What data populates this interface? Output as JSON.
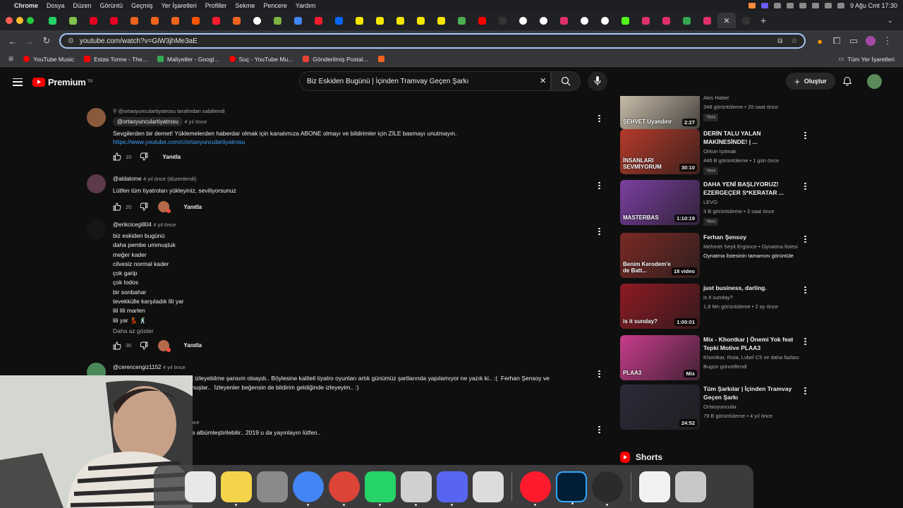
{
  "menubar": {
    "apple": "",
    "app_name": "Chrome",
    "items": [
      "Dosya",
      "Düzen",
      "Görüntü",
      "Geçmiş",
      "Yer İşaretleri",
      "Profiller",
      "Sekme",
      "Pencere",
      "Yardım"
    ],
    "clock": "9 Ağu Cmt  17:30"
  },
  "browser": {
    "tabs": [
      {
        "icon": "whatsapp-icon",
        "color": "#25d366"
      },
      {
        "icon": "ekşi-icon",
        "color": "#81c14b"
      },
      {
        "icon": "pinterest-icon",
        "color": "#e60023"
      },
      {
        "icon": "pinterest-icon",
        "color": "#e60023"
      },
      {
        "icon": "etsy-icon",
        "color": "#f1641e"
      },
      {
        "icon": "etsy-icon",
        "color": "#f1641e"
      },
      {
        "icon": "etsy-icon",
        "color": "#f1641e"
      },
      {
        "icon": "soundcloud-icon",
        "color": "#ff5500"
      },
      {
        "icon": "opera-icon",
        "color": "#ff1b2d"
      },
      {
        "icon": "etsy-icon",
        "color": "#f1641e"
      },
      {
        "icon": "google-icon",
        "color": "#ffffff"
      },
      {
        "icon": "pencil-icon",
        "color": "#7cb342"
      },
      {
        "icon": "translate-icon",
        "color": "#4285f4"
      },
      {
        "icon": "opera-icon",
        "color": "#ff1b2d"
      },
      {
        "icon": "meta-icon",
        "color": "#0866ff"
      },
      {
        "icon": "s-icon",
        "color": "#f7e600"
      },
      {
        "icon": "s-icon",
        "color": "#f7e600"
      },
      {
        "icon": "s-icon",
        "color": "#f7e600"
      },
      {
        "icon": "s-icon",
        "color": "#f7e600"
      },
      {
        "icon": "s-icon",
        "color": "#f7e600"
      },
      {
        "icon": "drop-icon",
        "color": "#4caf50"
      },
      {
        "icon": "youtube-icon",
        "color": "#ff0000"
      },
      {
        "icon": "triangle-icon",
        "color": "#333333"
      },
      {
        "icon": "chatgpt-icon",
        "color": "#ffffff"
      },
      {
        "icon": "chatgpt-icon",
        "color": "#ffffff"
      },
      {
        "icon": "instagram-icon",
        "color": "#e1306c"
      },
      {
        "icon": "chatgpt-icon",
        "color": "#ffffff"
      },
      {
        "icon": "chatgpt-icon",
        "color": "#ffffff"
      },
      {
        "icon": "kick-icon",
        "color": "#53fc18"
      },
      {
        "icon": "instagram-icon",
        "color": "#e1306c"
      },
      {
        "icon": "instagram-icon",
        "color": "#e1306c"
      },
      {
        "icon": "sheets-icon",
        "color": "#34a853"
      },
      {
        "icon": "instagram-icon",
        "color": "#e1306c"
      }
    ],
    "url": "youtube.com/watch?v=GiW3jhMe3aE",
    "bookmarks": [
      {
        "label": "YouTube Music",
        "color": "#ff0000"
      },
      {
        "label": "Estas Tonne - The...",
        "color": "#ff0000"
      },
      {
        "label": "Maliyetler - Googl...",
        "color": "#34a853"
      },
      {
        "label": "Suç - YouTube Mu...",
        "color": "#ff0000"
      },
      {
        "label": "Gönderilmiş Postal...",
        "color": "#ea4335"
      },
      {
        "label": "",
        "color": "#f1641e"
      }
    ],
    "all_bookmarks": "Tüm Yer İşaretleri"
  },
  "youtube": {
    "logo_word": "Premium",
    "logo_region": "TR",
    "search_value": "Biz Eskiden Bugünü | İçinden Tramvay Geçen Şarkı",
    "create_label": "Oluştur"
  },
  "comments": [
    {
      "pinned": "ortaoyunculartiyatrosu tarafından sabitlendi",
      "author": "@ortaoyunculartiyatrosu",
      "time": "4 yıl önce",
      "text": "Sevgilerden bir demet! Yüklemelerden haberdar olmak için kanalımıza ABONE olmayı ve bildirimler için ZİLE basmayı unutmayın.",
      "link": "https://www.youtube.com/c/ortaoyunculartiyatrosu",
      "likes": "10",
      "reply": "Yanıtla"
    },
    {
      "author": "@aldalome",
      "time": "4 yıl önce (düzenlendi)",
      "text": "Lütfen tüm tiyatroları yükleyiniz, seviliyorsunuz",
      "likes": "20",
      "reply": "Yanıtla"
    },
    {
      "author": "@erikcicegi804",
      "time": "4 yıl önce",
      "text": "biz eskiden bugünü\ndaha pembe ummuştuk\nmeğer kader\ncilvesiz normal kader\nçok garip\nçok lodos\nbir sonbahar\ntevekkülle karşıladık lili yar\nlili lili marlen\nlili yar 💃 🕺",
      "show_less": "Daha az göster",
      "likes": "30",
      "reply": "Yanıtla"
    },
    {
      "author": "@cerencengiz1152",
      "time": "4 yıl önce",
      "text": "Keşke zamanında canlı olarak izleyebilme şansım olsaydı.. Böylesine kaliteli tiyatro oyunları artık günümüz şartlarında yapılamıyor ne yazık ki.. :(  Ferhan Şensoy ve\n...yuncular kalitesini konuşturmuşlar..  İzleyenler beğensin de bildirim geldiğinde izleyeyim.. :)",
      "next_fragment": "...et. Müzikleri bile başlı başına albümleştirilebilir.. 2019 u da yayınlayın lütfen..",
      "next_time": "...önce"
    }
  ],
  "related": [
    {
      "title": "...",
      "thumb_text": "ŞEHVET Uyandırır",
      "channel": "Akis Haber",
      "meta": "348 görüntüleme • 20 saat önce",
      "badge": "Yeni",
      "duration": "2:27",
      "thumb_color": "#d6c9b5"
    },
    {
      "title": "DERİN TALU YALAN MAKİNESİNDE! | ...",
      "thumb_text": "İNSANLARI SEVMİYORUM",
      "channel": "Orkun Işıtmak",
      "meta": "446 B görüntüleme • 1 gün önce",
      "badge": "Yeni",
      "duration": "30:10",
      "thumb_color": "#b53a2a"
    },
    {
      "title": "DAHA YENİ BAŞLIYORUZ! EZERGEÇER S*KERATAR ...",
      "thumb_text": "MASTERBAS",
      "channel": "LEVO",
      "meta": "3 B görüntüleme • 3 saat önce",
      "badge": "Yeni",
      "duration": "1:10:19",
      "thumb_color": "#7b3fa0"
    },
    {
      "title": "Ferhan Şensoy",
      "thumb_text": "Benim Kerodem'e de Batt...",
      "channel": "Mehmet Seyit Ergünce • Oynatma listesi",
      "meta": "Oynatma listesinin tamamını görüntüle",
      "duration": "18 video",
      "thumb_color": "#7a2a26"
    },
    {
      "title": "just business, darling.",
      "thumb_text": "is it sunday?",
      "channel": "is it sunday?",
      "meta": "1,8 Mn görüntüleme • 2 ay önce",
      "duration": "1:00:01",
      "thumb_color": "#8e1a24"
    },
    {
      "title": "Mix - Khontkar |  Önemi Yok feat Tepki  Motive PLAA3",
      "thumb_text": "PLAA3",
      "channel": "Khontkar, Rota, Lvbel C5 ve daha fazlası",
      "meta": "Bugün güncellendi",
      "duration": "Mix",
      "thumb_color": "#c83c8c"
    },
    {
      "title": "Tüm Şarkılar | İçinden Tramvay Geçen Şarkı",
      "thumb_text": "",
      "channel": "Ortaoyuncular",
      "meta": "79 B görüntüleme • 4 yıl önce",
      "duration": "24:52",
      "thumb_color": "#2b2b3a"
    }
  ],
  "shorts_label": "Shorts",
  "dock": [
    {
      "name": "launchpad-icon",
      "color": "#e8e8e8"
    },
    {
      "name": "notes-icon",
      "color": "#f5d44a"
    },
    {
      "name": "settings-icon",
      "color": "#8a8a8a"
    },
    {
      "name": "chrome-icon",
      "color": "#4285f4"
    },
    {
      "name": "chrome-icon",
      "color": "#db4437"
    },
    {
      "name": "whatsapp-icon",
      "color": "#25d366"
    },
    {
      "name": "iphone-mirroring-icon",
      "color": "#d0d0d0"
    },
    {
      "name": "discord-icon",
      "color": "#5865f2"
    },
    {
      "name": "printer-icon",
      "color": "#dcdcdc"
    },
    {
      "name": "opera-icon",
      "color": "#ff1b2d"
    },
    {
      "name": "photoshop-icon",
      "color": "#001e36"
    },
    {
      "name": "obs-icon",
      "color": "#2b2b2b"
    },
    {
      "name": "document-icon",
      "color": "#f2f2f2"
    },
    {
      "name": "trash-icon",
      "color": "#c8c8c8"
    }
  ]
}
